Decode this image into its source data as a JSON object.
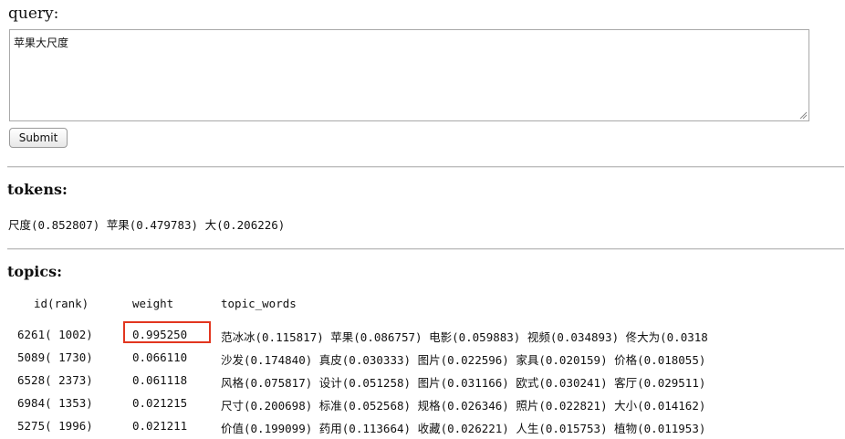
{
  "query": {
    "label": "query:",
    "value": "苹果大尺度"
  },
  "submit_label": "Submit",
  "tokens": {
    "heading": "tokens:",
    "line": "尺度(0.852807) 苹果(0.479783) 大(0.206226)"
  },
  "topics": {
    "heading": "topics:",
    "columns": [
      "id(rank)",
      "weight",
      "topic_words"
    ],
    "rows": [
      {
        "id_rank": "6261( 1002)",
        "weight": "0.995250",
        "topic_words": "范冰冰(0.115817) 苹果(0.086757) 电影(0.059883) 视频(0.034893) 佟大为(0.0318"
      },
      {
        "id_rank": "5089( 1730)",
        "weight": "0.066110",
        "topic_words": "沙发(0.174840) 真皮(0.030333) 图片(0.022596) 家具(0.020159) 价格(0.018055)"
      },
      {
        "id_rank": "6528( 2373)",
        "weight": "0.061118",
        "topic_words": "风格(0.075817) 设计(0.051258) 图片(0.031166) 欧式(0.030241) 客厅(0.029511)"
      },
      {
        "id_rank": "6984( 1353)",
        "weight": "0.021215",
        "topic_words": "尺寸(0.200698) 标准(0.052568) 规格(0.026346) 照片(0.022821) 大小(0.014162)"
      },
      {
        "id_rank": "5275( 1996)",
        "weight": "0.021211",
        "topic_words": "价值(0.199099) 药用(0.113664) 收藏(0.026221) 人生(0.015753) 植物(0.011953)"
      }
    ]
  },
  "colors": {
    "highlight_border": "#e2361f"
  }
}
